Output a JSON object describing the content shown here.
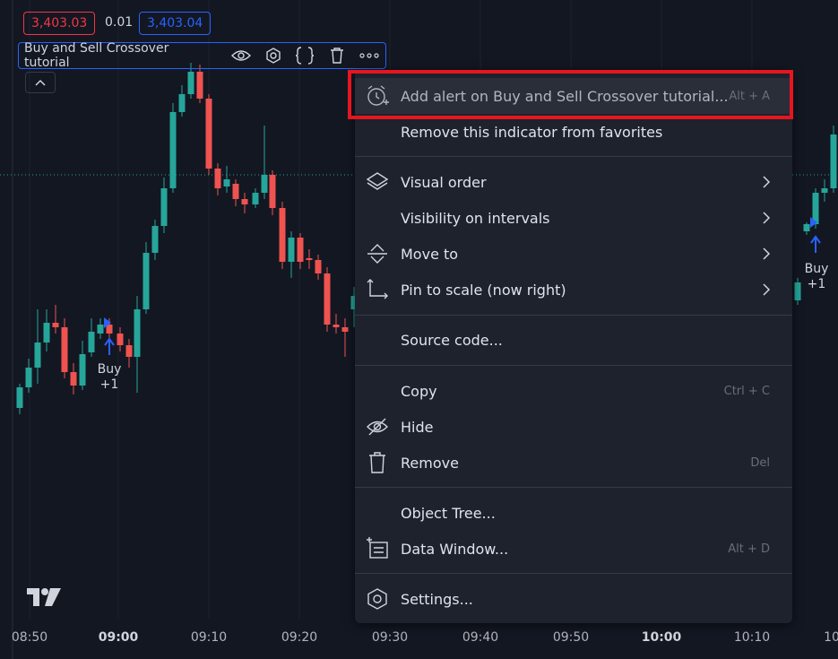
{
  "price": {
    "bid": "3,403.03",
    "spread": "0.01",
    "ask": "3,403.04"
  },
  "indicator": {
    "title": "Buy and Sell Crossover tutorial"
  },
  "signals": [
    {
      "label": "Buy",
      "qty": "+1"
    },
    {
      "label": "Buy",
      "qty": "+1"
    }
  ],
  "time_axis": [
    "08:50",
    "09:00",
    "09:10",
    "09:20",
    "09:30",
    "09:40",
    "09:50",
    "10:00",
    "10:10",
    "10"
  ],
  "menu": {
    "add_alert": {
      "label": "Add alert on Buy and Sell Crossover tutorial...",
      "shortcut": "Alt + A"
    },
    "remove_favorites": "Remove this indicator from favorites",
    "visual_order": "Visual order",
    "visibility_intervals": "Visibility on intervals",
    "move_to": "Move to",
    "pin_to_scale": "Pin to scale (now right)",
    "source_code": "Source code...",
    "copy": {
      "label": "Copy",
      "shortcut": "Ctrl + C"
    },
    "hide": "Hide",
    "remove": {
      "label": "Remove",
      "shortcut": "Del"
    },
    "object_tree": "Object Tree...",
    "data_window": {
      "label": "Data Window...",
      "shortcut": "Alt + D"
    },
    "settings": "Settings..."
  },
  "colors": {
    "up": "#26a69a",
    "down": "#ef5350",
    "highlight": "#e5161e",
    "accent": "#2962ff"
  }
}
